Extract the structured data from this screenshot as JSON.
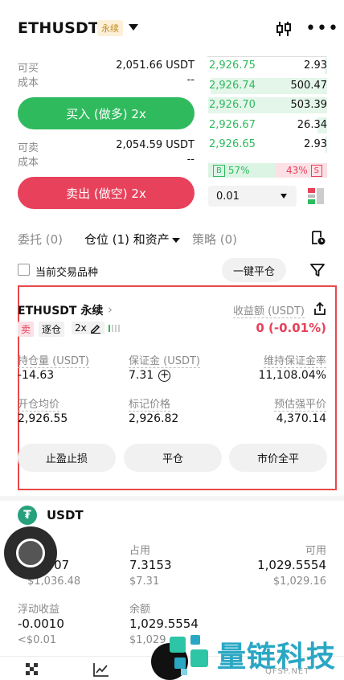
{
  "header": {
    "title": "ETHUSDT",
    "badge": "永续"
  },
  "form": {
    "buy_rows": [
      {
        "label": "可买",
        "value": "2,051.66 USDT"
      },
      {
        "label": "成本",
        "value": "--"
      }
    ],
    "buy_button": "买入 (做多) 2x",
    "sell_rows": [
      {
        "label": "可卖",
        "value": "2,054.59 USDT"
      },
      {
        "label": "成本",
        "value": "--"
      }
    ],
    "sell_button": "卖出 (做空) 2x"
  },
  "orderbook": {
    "bids": [
      {
        "price": "2,926.75",
        "qty": "2.93",
        "depth": 0.02
      },
      {
        "price": "2,926.74",
        "qty": "500.47",
        "depth": 0.98
      },
      {
        "price": "2,926.70",
        "qty": "503.39",
        "depth": 1.0
      },
      {
        "price": "2,926.67",
        "qty": "26.34",
        "depth": 0.08
      },
      {
        "price": "2,926.65",
        "qty": "2.93",
        "depth": 0.02
      }
    ],
    "buy_tag": "B",
    "buy_ratio": "57%",
    "sell_ratio": "43%",
    "sell_tag": "S",
    "buy_fraction": 0.57,
    "precision": "0.01"
  },
  "tabs": {
    "orders": "委托 (0)",
    "positions": "仓位 (1) 和资产",
    "strategies": "策略 (0)"
  },
  "filter": {
    "checkbox_label": "当前交易品种",
    "close_all": "一键平仓"
  },
  "position": {
    "symbol": "ETHUSDT 永续",
    "pnl_label": "收益额 (USDT)",
    "side": "卖",
    "margin_mode": "逐仓",
    "leverage": "2x",
    "pnl_value": "0 (-0.01%)",
    "fields": [
      {
        "label": "持仓量 (USDT)",
        "value": "-14.63"
      },
      {
        "label": "保证金 (USDT)",
        "value": "7.31"
      },
      {
        "label": "维持保证金率",
        "value": "11,108.04%"
      },
      {
        "label": "开仓均价",
        "value": "2,926.55"
      },
      {
        "label": "标记价格",
        "value": "2,926.82"
      },
      {
        "label": "预估强平价",
        "value": "4,370.14"
      }
    ],
    "buttons": [
      "止盈止损",
      "平仓",
      "市价全平"
    ]
  },
  "assets": {
    "currency": "USDT",
    "col1": {
      "value": "8707",
      "sub": "$1,036.48"
    },
    "col2": {
      "label": "占用",
      "value": "7.3153",
      "sub": "$7.31"
    },
    "col3": {
      "label": "可用",
      "value": "1,029.5554",
      "sub": "$1,029.16"
    },
    "row2_col1": {
      "label": "浮动收益",
      "value": "-0.0010",
      "sub": "<$0.01"
    },
    "row2_col2": {
      "label": "余额",
      "value": "1,029.5554",
      "sub": "$1,029"
    }
  },
  "watermark": {
    "text": "量链科技",
    "sub": "QFSP.NET"
  },
  "colors": {
    "green": "#2fba5e",
    "red": "#e8415b",
    "highlight": "#e84a4a"
  }
}
